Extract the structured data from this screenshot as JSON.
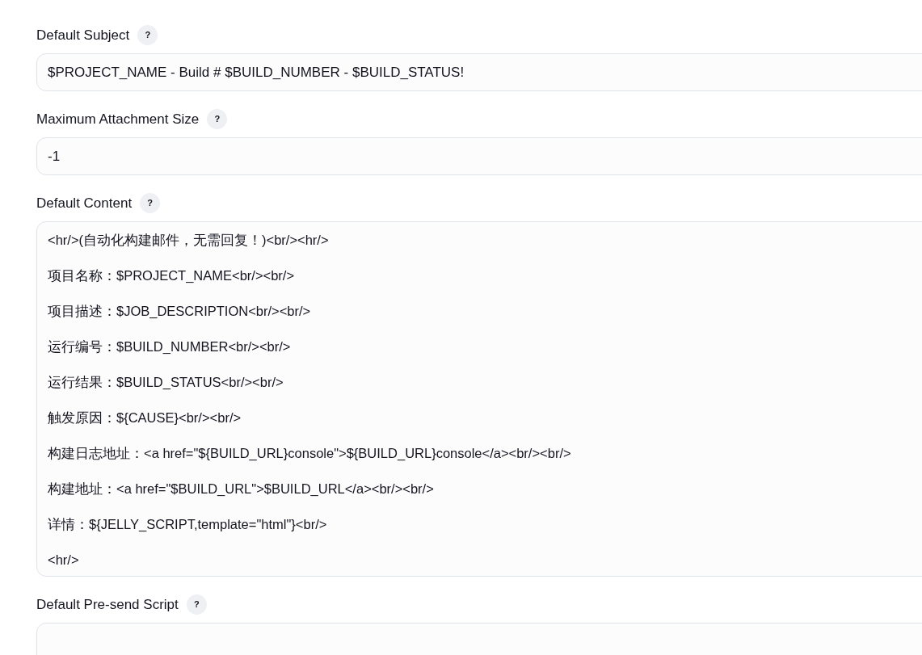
{
  "fields": [
    {
      "kind": "input",
      "label": "Default Subject",
      "help": "?",
      "value": "$PROJECT_NAME - Build # $BUILD_NUMBER - $BUILD_STATUS!"
    },
    {
      "kind": "input",
      "label": "Maximum Attachment Size",
      "help": "?",
      "value": "-1"
    },
    {
      "kind": "textarea",
      "label": "Default Content",
      "help": "?",
      "lines": [
        "<hr/>(自动化构建邮件，无需回复！)<br/><hr/>",
        "项目名称：$PROJECT_NAME<br/><br/>",
        "项目描述：$JOB_DESCRIPTION<br/><br/>",
        "运行编号：$BUILD_NUMBER<br/><br/>",
        "运行结果：$BUILD_STATUS<br/><br/>",
        "触发原因：${CAUSE}<br/><br/>",
        "构建日志地址：<a href=\"${BUILD_URL}console\">${BUILD_URL}console</a><br/><br/>",
        "构建地址：<a href=\"$BUILD_URL\">$BUILD_URL</a><br/><br/>",
        "详情：${JELLY_SCRIPT,template=\"html\"}<br/>",
        "<hr/>"
      ]
    },
    {
      "kind": "textarea",
      "label": "Default Pre-send Script",
      "help": "?"
    }
  ]
}
